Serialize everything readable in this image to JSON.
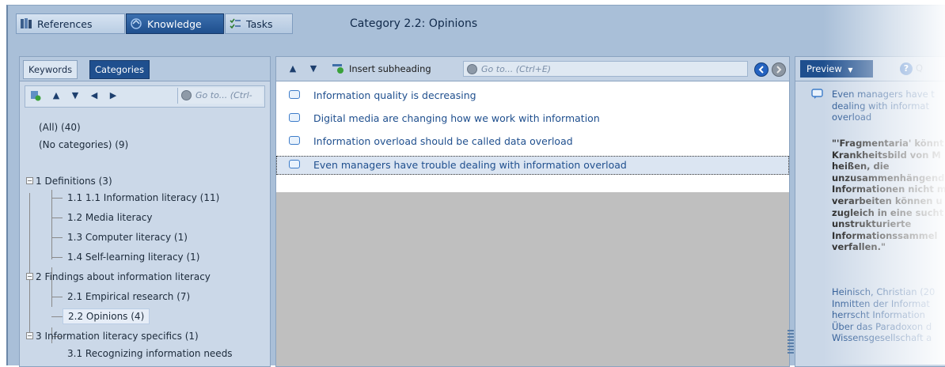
{
  "top_tabs": {
    "references": "References",
    "knowledge": "Knowledge",
    "tasks": "Tasks"
  },
  "page_title": "Category 2.2:  Opinions",
  "left_panel": {
    "tabs": {
      "keywords": "Keywords",
      "categories": "Categories"
    },
    "goto_placeholder": "Go to... (Ctrl-",
    "tree": {
      "all": "(All) (40)",
      "none": "(No categories) (9)",
      "c1": "1 Definitions (3)",
      "c1_1": "1.1 1.1 Information literacy (11)",
      "c1_2": "1.2 Media literacy",
      "c1_3": "1.3 Computer literacy (1)",
      "c1_4": "1.4 Self-learning literacy (1)",
      "c2": "2 Findings about information literacy",
      "c2_1": "2.1 Empirical research (7)",
      "c2_2": "2.2 Opinions (4)",
      "c3": "3 Information literacy specifics (1)",
      "c3_1": "3.1 Recognizing information needs"
    }
  },
  "middle_panel": {
    "insert_subheading": "Insert subheading",
    "goto_placeholder": "Go to...  (Ctrl+E)",
    "items": [
      "Information quality is decreasing",
      "Digital media are changing how we work with information",
      "Information overload should be called data overload",
      "Even managers have trouble dealing with information overload"
    ]
  },
  "right_panel": {
    "preview_label": "Preview",
    "help_label": "Q",
    "title": "Even managers have t\ndealing with informat\noverload",
    "quote": "\"'Fragmentaria' könnt\nKrankheitsbild von M\nheißen, die\nunzusammenhängend\nInformationen nicht m\nverarbeiten können u\nzugleich in eine sucht\nunstrukturierte\nInformationssammel\nverfallen.\"",
    "source": "Heinisch, Christian (20\nInmitten der Informat\nherrscht Information\nÜber das Paradoxon d\nWissensgesellschaft a"
  },
  "colors": {
    "accent": "#1f4f8e",
    "panel_bg": "#cbd8e8",
    "link_blue": "#1f4f8e"
  }
}
